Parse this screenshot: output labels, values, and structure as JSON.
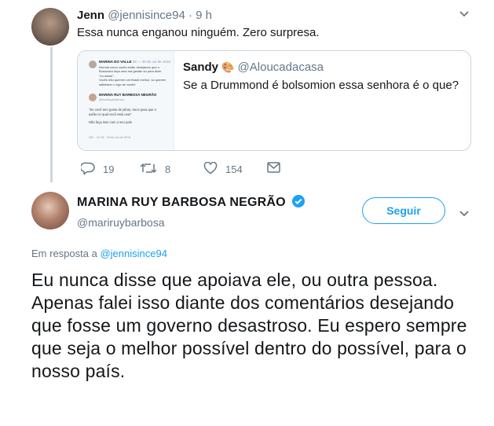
{
  "reply_tweet": {
    "author_name": "Jenn",
    "handle": "@jennisince94",
    "time": "· 9 h",
    "text": "Essa nunca enganou ninguém. Zero surpresa."
  },
  "quoted_tweet": {
    "author_name": "Sandy",
    "author_emoji": "🎨",
    "handle": "@Aloucadacasa",
    "text": "Se a Drummond é bolsomion essa senhora é o que?",
    "thumbnail": {
      "line1_name": "MARINA DO VALLE",
      "line1_meta": "29 — 29 de out de 2018",
      "body_lines": [
        "Normal como vocês estão desejando que o",
        "Bolsonaro faça uma má gestão só para dizer",
        "\"eu avisei\".",
        "Vocês não querem um Brasil melhor, só querem",
        "satisfazer o ego de vocês!"
      ],
      "quoted_name": "MARINA RUY BARBOSA NEGRÃO",
      "quoted_handle": "@mariruybarbosa",
      "quoted_lines": [
        "\"Se você tem gosto de piloto, torce para que o",
        "avião no qual você está caia\"",
        "",
        "Não faça isso com o seu país"
      ],
      "footer": "200 · 12:18 · 29 de out de 2018"
    }
  },
  "actions": {
    "replies": "19",
    "retweets": "8",
    "likes": "154"
  },
  "main_tweet": {
    "author_name": "MARINA RUY BARBOSA NEGRÃO",
    "handle": "@mariruybarbosa",
    "follow_label": "Seguir",
    "reply_to_prefix": "Em resposta a",
    "reply_to_handle": "@jennisince94",
    "text": "Eu nunca disse que apoiava ele, ou outra pessoa. Apenas falei isso diante dos comentários desejando que fosse um governo desastroso. Eu espero sempre que seja o melhor possível dentro do possível, para o nosso país."
  },
  "colors": {
    "accent": "#1da1f2",
    "muted": "#657786",
    "border": "#ccd6dd",
    "verified": "#1da1f2"
  },
  "icons": [
    "reply-icon",
    "retweet-icon",
    "like-icon",
    "message-icon",
    "chevron-down-icon",
    "verified-badge-icon"
  ]
}
